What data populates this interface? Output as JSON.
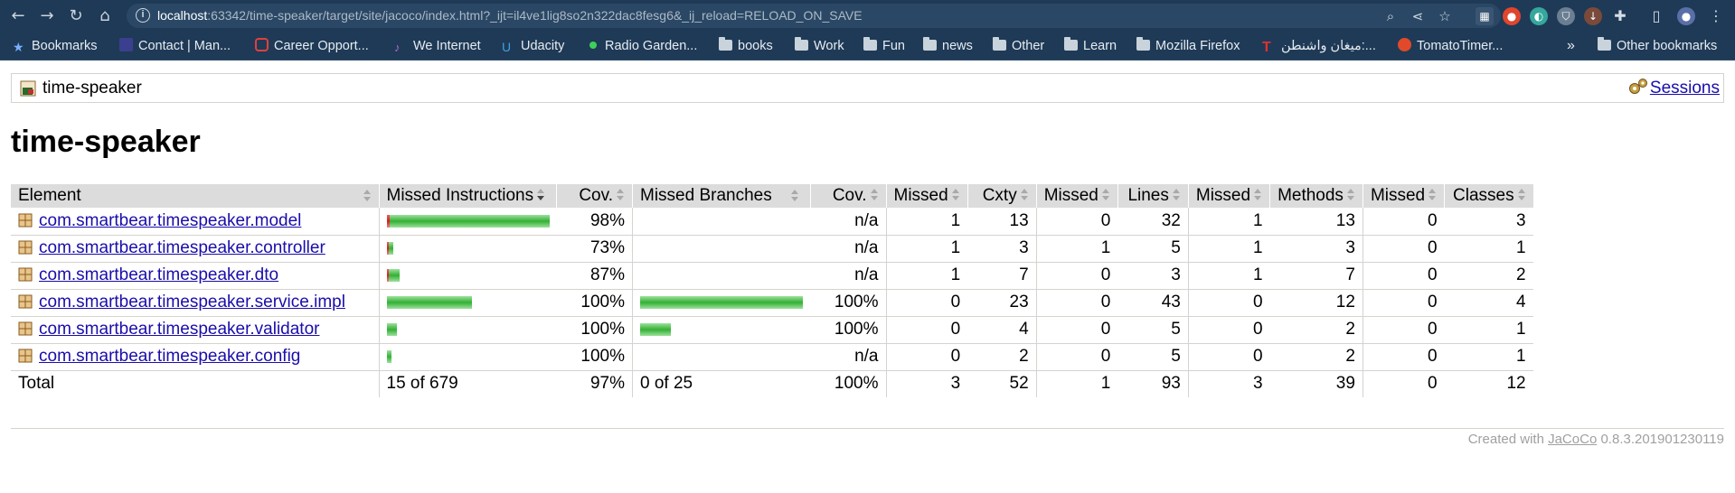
{
  "browser": {
    "url_host": "localhost",
    "url_rest": ":63342/time-speaker/target/site/jacoco/index.html?_ijt=il4ve1lig8so2n322dac8fesg6&_ij_reload=RELOAD_ON_SAVE",
    "bookmarks": [
      {
        "label": "Bookmarks",
        "icon": "star-icon"
      },
      {
        "label": "Contact | Man...",
        "icon": "site-icon"
      },
      {
        "label": "Career Opport...",
        "icon": "site-icon"
      },
      {
        "label": "We Internet",
        "icon": "site-icon"
      },
      {
        "label": "Udacity",
        "icon": "site-icon"
      },
      {
        "label": "Radio Garden...",
        "icon": "site-icon"
      },
      {
        "label": "books",
        "icon": "folder-icon"
      },
      {
        "label": "Work",
        "icon": "folder-icon"
      },
      {
        "label": "Fun",
        "icon": "folder-icon"
      },
      {
        "label": "news",
        "icon": "folder-icon"
      },
      {
        "label": "Other",
        "icon": "folder-icon"
      },
      {
        "label": "Learn",
        "icon": "folder-icon"
      },
      {
        "label": "Mozilla Firefox",
        "icon": "folder-icon"
      },
      {
        "label": "ميغان واشنطن:...",
        "icon": "site-icon"
      },
      {
        "label": "TomatoTimer...",
        "icon": "site-icon"
      }
    ],
    "overflow": "»",
    "other_bookmarks": "Other bookmarks"
  },
  "page": {
    "breadcrumb": "time-speaker",
    "sessions_link": "Sessions",
    "title": "time-speaker"
  },
  "table": {
    "headers": [
      "Element",
      "Missed Instructions",
      "Cov.",
      "Missed Branches",
      "Cov.",
      "Missed",
      "Cxty",
      "Missed",
      "Lines",
      "Missed",
      "Methods",
      "Missed",
      "Classes"
    ],
    "rows": [
      {
        "element": "com.smartbear.timespeaker.model",
        "instr_missed_frac": 0.0168,
        "instr_covered_frac": 0.9832,
        "instr_cov": "98%",
        "branch_missed_frac": 0,
        "branch_covered_frac": 0,
        "branch_cov": "n/a",
        "cx_missed": "1",
        "cxty": "13",
        "lines_missed": "0",
        "lines": "32",
        "meth_missed": "1",
        "methods": "13",
        "cls_missed": "0",
        "classes": "3"
      },
      {
        "element": "com.smartbear.timespeaker.controller",
        "instr_missed_frac": 0.011,
        "instr_covered_frac": 0.03,
        "instr_cov": "73%",
        "branch_missed_frac": 0,
        "branch_covered_frac": 0,
        "branch_cov": "n/a",
        "cx_missed": "1",
        "cxty": "3",
        "lines_missed": "1",
        "lines": "5",
        "meth_missed": "1",
        "methods": "3",
        "cls_missed": "0",
        "classes": "1"
      },
      {
        "element": "com.smartbear.timespeaker.dto",
        "instr_missed_frac": 0.01,
        "instr_covered_frac": 0.068,
        "instr_cov": "87%",
        "branch_missed_frac": 0,
        "branch_covered_frac": 0,
        "branch_cov": "n/a",
        "cx_missed": "1",
        "cxty": "7",
        "lines_missed": "0",
        "lines": "3",
        "meth_missed": "1",
        "methods": "7",
        "cls_missed": "0",
        "classes": "2"
      },
      {
        "element": "com.smartbear.timespeaker.service.impl",
        "instr_missed_frac": 0,
        "instr_covered_frac": 0.52,
        "instr_cov": "100%",
        "branch_missed_frac": 0,
        "branch_covered_frac": 1.0,
        "branch_cov": "100%",
        "cx_missed": "0",
        "cxty": "23",
        "lines_missed": "0",
        "lines": "43",
        "meth_missed": "0",
        "methods": "12",
        "cls_missed": "0",
        "classes": "4"
      },
      {
        "element": "com.smartbear.timespeaker.validator",
        "instr_missed_frac": 0,
        "instr_covered_frac": 0.06,
        "instr_cov": "100%",
        "branch_missed_frac": 0,
        "branch_covered_frac": 0.19,
        "branch_cov": "100%",
        "cx_missed": "0",
        "cxty": "4",
        "lines_missed": "0",
        "lines": "5",
        "meth_missed": "0",
        "methods": "2",
        "cls_missed": "0",
        "classes": "1"
      },
      {
        "element": "com.smartbear.timespeaker.config",
        "instr_missed_frac": 0,
        "instr_covered_frac": 0.03,
        "instr_cov": "100%",
        "branch_missed_frac": 0,
        "branch_covered_frac": 0,
        "branch_cov": "n/a",
        "cx_missed": "0",
        "cxty": "2",
        "lines_missed": "0",
        "lines": "5",
        "meth_missed": "0",
        "methods": "2",
        "cls_missed": "0",
        "classes": "1"
      }
    ],
    "total": {
      "label": "Total",
      "instr": "15 of 679",
      "instr_cov": "97%",
      "branch": "0 of 25",
      "branch_cov": "100%",
      "cx_missed": "3",
      "cxty": "52",
      "lines_missed": "1",
      "lines": "93",
      "meth_missed": "3",
      "methods": "39",
      "cls_missed": "0",
      "classes": "12"
    }
  },
  "footer": {
    "prefix": "Created with ",
    "link": "JaCoCo",
    "version": " 0.8.3.201901230119"
  },
  "colors": {
    "bar_covered": "#34b034",
    "bar_missed": "#d02020",
    "link": "#1a0dab"
  }
}
